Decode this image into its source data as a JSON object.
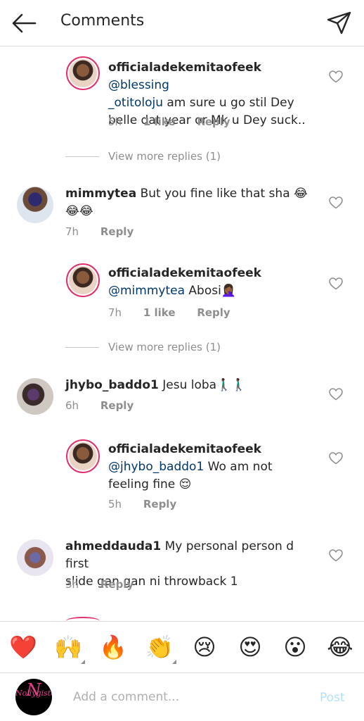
{
  "header": {
    "title": "Comments"
  },
  "comments": [
    {
      "user": "officialadekemitaofeek",
      "mention": "@blessing_otitoloju",
      "line1_mention": "@blessing",
      "line2_mention": "_otitoloju",
      "line2_text": " am sure u go stil Dey",
      "line3_text": "belle dat year or Mk u Dey suck..",
      "time": "5h",
      "likes": "1 like",
      "reply": "Reply"
    },
    {
      "user": "mimmytea",
      "text_line1": " But you fine like that sha 😂",
      "text_line2": "😂😂",
      "time": "7h",
      "reply": "Reply"
    },
    {
      "user": "officialadekemitaofeek",
      "mention": "@mimmytea",
      "text": " Abosi🤦🏾‍♀️",
      "time": "7h",
      "likes": "1 like",
      "reply": "Reply"
    },
    {
      "user": "jhybo_baddo1",
      "text": " Jesu loba🚶🏿‍♂️🚶🏿‍♂️",
      "time": "6h",
      "reply": "Reply"
    },
    {
      "user": "officialadekemitaofeek",
      "mention": "@jhybo_baddo1",
      "text_line2": " Wo am not",
      "text_line3": "feeling fine 😌",
      "time": "5h",
      "reply": "Reply"
    },
    {
      "user": "ahmeddauda1",
      "text_line1": " My personal person d first",
      "text_line2": "slide gan gan ni throwback 1",
      "time": "3h",
      "reply": "Reply"
    }
  ],
  "view_more_1": "View more replies (1)",
  "view_more_2": "View more replies (1)",
  "emojis": [
    "❤️",
    "🙌",
    "🔥",
    "👏",
    "😢",
    "😍",
    "😮",
    "😂"
  ],
  "input": {
    "placeholder": "Add a comment...",
    "post": "Post",
    "avatar_text": "Nollygisto"
  },
  "colors": {
    "mention": "#00376b",
    "muted": "#8e8e8e",
    "post": "#b2dffc",
    "ring": "#e1306c"
  }
}
